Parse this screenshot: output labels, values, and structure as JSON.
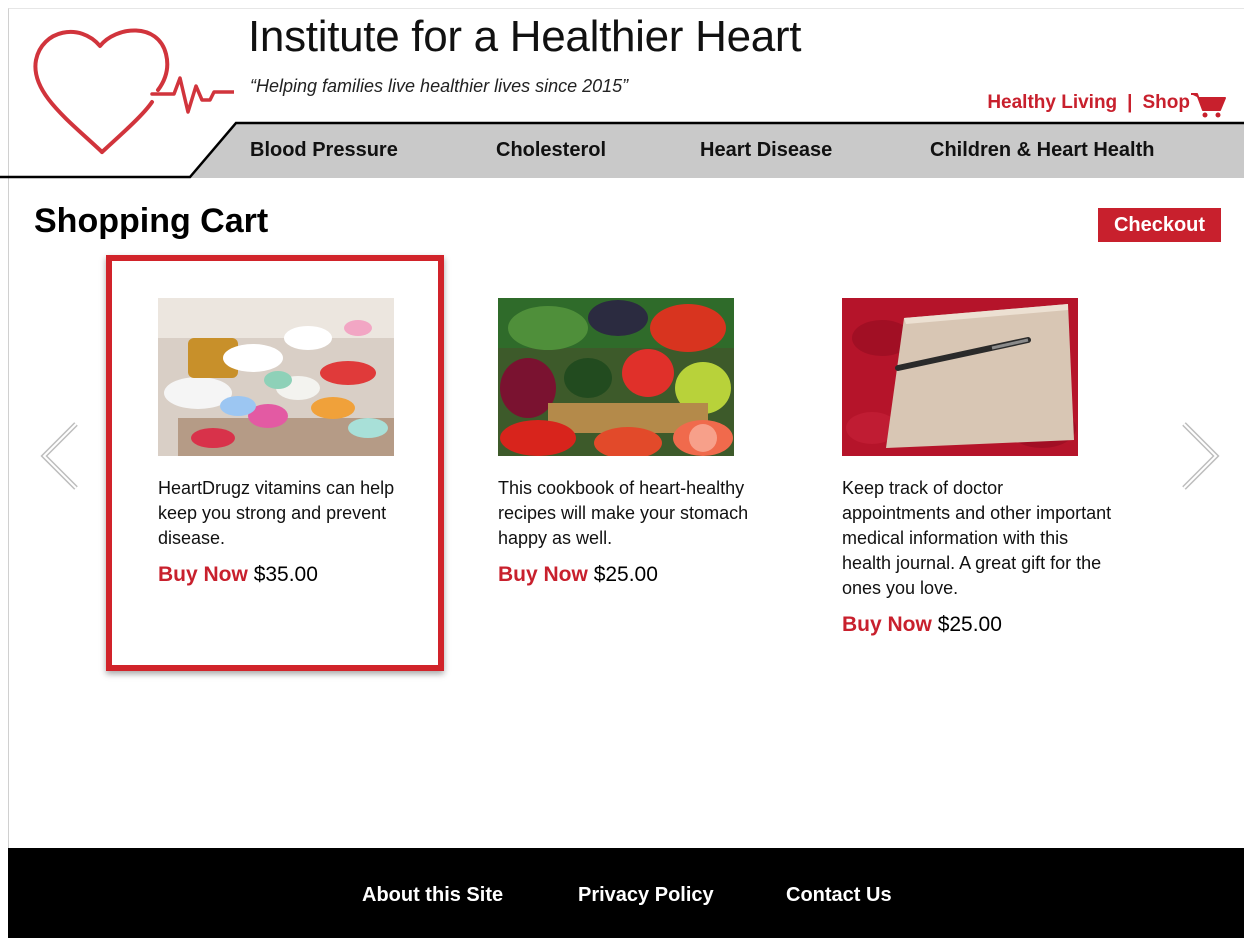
{
  "header": {
    "site_title": "Institute for a Healthier Heart",
    "tagline": "“Helping families live healthier lives since 2015”",
    "util_nav": {
      "healthy_living": "Healthy Living",
      "separator": "|",
      "shop": "Shop"
    }
  },
  "main_nav": [
    "Blood Pressure",
    "Cholesterol",
    "Heart Disease",
    "Children & Heart Health"
  ],
  "page": {
    "title": "Shopping Cart",
    "checkout_label": "Checkout"
  },
  "products": [
    {
      "description": "HeartDrugz vitamins can help keep you strong and prevent disease.",
      "buy_label": "Buy Now",
      "price": "$35.00",
      "image": "pills-photo"
    },
    {
      "description": "This cookbook of heart-healthy recipes will make your stomach happy as well.",
      "buy_label": "Buy Now",
      "price": "$25.00",
      "image": "vegetables-photo"
    },
    {
      "description": "Keep track of doctor appointments and other important medical information with this health journal. A great gift for the ones you love.",
      "buy_label": "Buy Now",
      "price": "$25.00",
      "image": "journal-photo"
    }
  ],
  "footer": {
    "about": "About this Site",
    "privacy": "Privacy Policy",
    "contact": "Contact Us"
  },
  "colors": {
    "brand_red": "#c8202d",
    "nav_gray": "#c9c9c9",
    "footer_bg": "#000000"
  }
}
